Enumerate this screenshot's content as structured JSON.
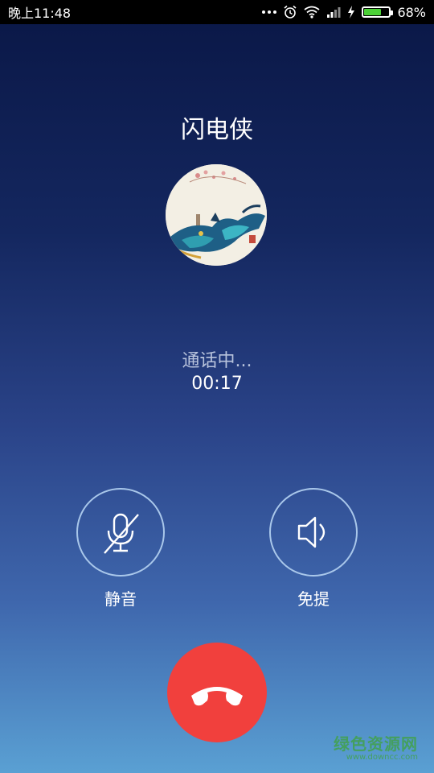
{
  "status_bar": {
    "time": "晚上11:48",
    "battery_percent": "68%",
    "battery_level": 0.68,
    "icons": [
      "more-dots-icon",
      "alarm-icon",
      "wifi-icon",
      "signal-icon",
      "charging-icon",
      "battery-icon"
    ]
  },
  "call": {
    "caller_name": "闪电侠",
    "status": "通话中...",
    "duration": "00:17"
  },
  "controls": {
    "mute_label": "静音",
    "speaker_label": "免提"
  },
  "colors": {
    "end_call": "#f1403d",
    "control_ring": "#a9c7ea",
    "battery_fill": "#4cd137"
  },
  "watermark": {
    "main": "绿色资源网",
    "sub": "www.downcc.com"
  }
}
